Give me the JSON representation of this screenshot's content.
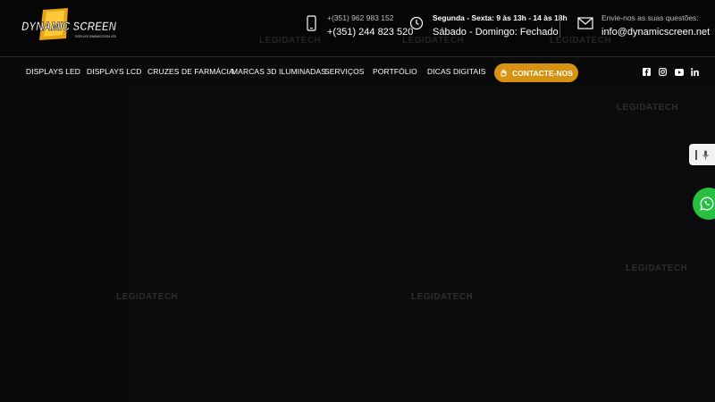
{
  "header": {
    "logo_text": "DYNAMIC SCREEN",
    "logo_subtext": "DISPLAYS DINÂMICOS EM LED",
    "phone_secondary": "+(351) 962 983 152",
    "phone_primary": "+(351) 244 823 520",
    "hours_weekday": "Segunda - Sexta: 9 às 13h - 14 às 18h",
    "hours_weekend": "Sábado - Domingo: Fechado",
    "email_label": "Envie-nos as suas questões:",
    "email": "info@dynamicscreen.net"
  },
  "nav": {
    "items": [
      {
        "label": "DISPLAYS LED"
      },
      {
        "label": "DISPLAYS LCD"
      },
      {
        "label": "CRUZES DE FARMÁCIA"
      },
      {
        "label": "MARCAS 3D ILUMINADAS"
      },
      {
        "label": "SERVIÇOS"
      },
      {
        "label": "PORTFÓLIO"
      },
      {
        "label": "DICAS DIGITAIS"
      }
    ],
    "cta_label": "CONTACTE-NOS",
    "social": [
      "facebook-icon",
      "instagram-icon",
      "youtube-icon",
      "linkedin-icon"
    ]
  },
  "watermark": "LEGIDATECH",
  "colors": {
    "accent": "#d69210",
    "whatsapp": "#28c043",
    "background": "#060606"
  }
}
